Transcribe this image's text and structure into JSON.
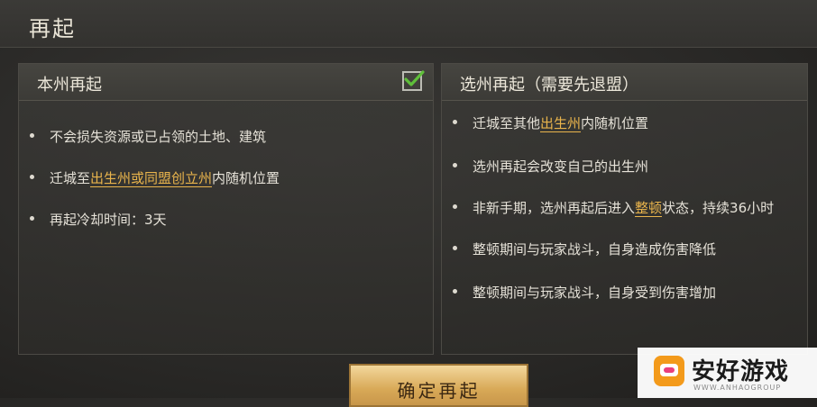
{
  "window": {
    "title": "再起"
  },
  "left_panel": {
    "header": "本州再起",
    "checked": true,
    "items": [
      {
        "parts": [
          {
            "text": "不会损失资源或已占领的土地、建筑",
            "highlight": false
          }
        ]
      },
      {
        "parts": [
          {
            "text": "迁城至",
            "highlight": false
          },
          {
            "text": "出生州或同盟创立州",
            "highlight": true
          },
          {
            "text": "内随机位置",
            "highlight": false
          }
        ]
      },
      {
        "parts": [
          {
            "text": "再起冷却时间：3天",
            "highlight": false
          }
        ]
      }
    ]
  },
  "right_panel": {
    "header": "选州再起（需要先退盟）",
    "items": [
      {
        "parts": [
          {
            "text": "迁城至其他",
            "highlight": false
          },
          {
            "text": "出生州",
            "highlight": true
          },
          {
            "text": "内随机位置",
            "highlight": false
          }
        ]
      },
      {
        "parts": [
          {
            "text": "选州再起会改变自己的出生州",
            "highlight": false
          }
        ]
      },
      {
        "parts": [
          {
            "text": "非新手期，选州再起后进入",
            "highlight": false
          },
          {
            "text": "整顿",
            "highlight": true
          },
          {
            "text": "状态，持续36小时",
            "highlight": false
          }
        ]
      },
      {
        "parts": [
          {
            "text": "整顿期间与玩家战斗，自身造成伤害降低",
            "highlight": false
          }
        ]
      },
      {
        "parts": [
          {
            "text": "整顿期间与玩家战斗，自身受到伤害增加",
            "highlight": false
          }
        ]
      }
    ]
  },
  "confirm_button": {
    "label": "确定再起"
  },
  "watermark": {
    "text": "安好游戏",
    "sub": "WWW.ANHAOGROUP",
    "icon": "gamepad-logo-icon"
  },
  "colors": {
    "highlight": "#e9b44c",
    "button": "#d8a957",
    "check": "#5fbf3a"
  }
}
